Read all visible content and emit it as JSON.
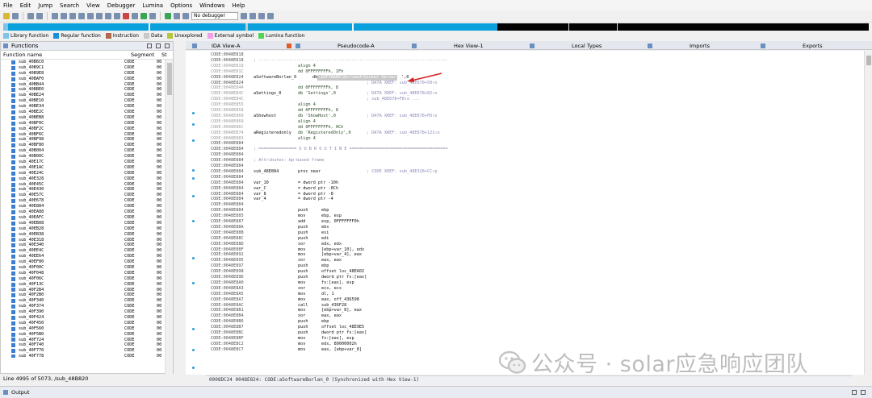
{
  "menubar": [
    "File",
    "Edit",
    "Jump",
    "Search",
    "View",
    "Debugger",
    "Lumina",
    "Options",
    "Windows",
    "Help"
  ],
  "toolbar": {
    "debugger_label": "No debugger"
  },
  "legend": [
    {
      "label": "Library function",
      "color": "#7fc4e8"
    },
    {
      "label": "Regular function",
      "color": "#1a8fd8"
    },
    {
      "label": "Instruction",
      "color": "#b06a4a"
    },
    {
      "label": "Data",
      "color": "#c8c8c8"
    },
    {
      "label": "Unexplored",
      "color": "#b8c43a"
    },
    {
      "label": "External symbol",
      "color": "#f0a0e8"
    },
    {
      "label": "Lumina function",
      "color": "#54d454"
    }
  ],
  "functions_panel": {
    "title": "Functions",
    "col_name": "Function name",
    "col_segment": "Segment",
    "col_s": "St",
    "rows": [
      [
        "sub_40B6C0",
        "CODE",
        "00"
      ],
      [
        "sub_40B9C1",
        "CODE",
        "00"
      ],
      [
        "sub_40B9E8",
        "CODE",
        "00"
      ],
      [
        "sub_40BAF0",
        "CODE",
        "00"
      ],
      [
        "sub_40BB44",
        "CODE",
        "00"
      ],
      [
        "sub_40BBE0",
        "CODE",
        "00"
      ],
      [
        "sub_40BE24",
        "CODE",
        "00"
      ],
      [
        "sub_40BE10",
        "CODE",
        "00"
      ],
      [
        "sub_40BE34",
        "CODE",
        "00"
      ],
      [
        "sub_40BE2C",
        "CODE",
        "00"
      ],
      [
        "sub_40BEB8",
        "CODE",
        "00"
      ],
      [
        "sub_40BF0C",
        "CODE",
        "00"
      ],
      [
        "sub_40BF2C",
        "CODE",
        "00"
      ],
      [
        "sub_40BF6C",
        "CODE",
        "00"
      ],
      [
        "sub_40BF98",
        "CODE",
        "00"
      ],
      [
        "sub_40BF80",
        "CODE",
        "00"
      ],
      [
        "sub_40B004",
        "CODE",
        "00"
      ],
      [
        "sub_40B00C",
        "CODE",
        "00"
      ],
      [
        "sub_40E17C",
        "CODE",
        "00"
      ],
      [
        "sub_40E1AC",
        "CODE",
        "00"
      ],
      [
        "sub_40E24C",
        "CODE",
        "00"
      ],
      [
        "sub_40E328",
        "CODE",
        "00"
      ],
      [
        "sub_40E45C",
        "CODE",
        "00"
      ],
      [
        "sub_40E430",
        "CODE",
        "00"
      ],
      [
        "sub_40E57C",
        "CODE",
        "00"
      ],
      [
        "sub_40E678",
        "CODE",
        "00"
      ],
      [
        "sub_40E884",
        "CODE",
        "00"
      ],
      [
        "sub_40EA88",
        "CODE",
        "00"
      ],
      [
        "sub_40EAFC",
        "CODE",
        "00"
      ],
      [
        "sub_40EB08",
        "CODE",
        "00"
      ],
      [
        "sub_40EB28",
        "CODE",
        "00"
      ],
      [
        "sub_40EB38",
        "CODE",
        "00"
      ],
      [
        "sub_40E318",
        "CODE",
        "00"
      ],
      [
        "sub_40E340",
        "CODE",
        "00"
      ],
      [
        "sub_40EE4C",
        "CODE",
        "00"
      ],
      [
        "sub_40EE64",
        "CODE",
        "00"
      ],
      [
        "sub_40EF80",
        "CODE",
        "00"
      ],
      [
        "sub_40F00C",
        "CODE",
        "00"
      ],
      [
        "sub_40F048",
        "CODE",
        "00"
      ],
      [
        "sub_40F06C",
        "CODE",
        "00"
      ],
      [
        "sub_40F13C",
        "CODE",
        "00"
      ],
      [
        "sub_40F2B4",
        "CODE",
        "00"
      ],
      [
        "sub_40F2B0",
        "CODE",
        "00"
      ],
      [
        "sub_40F340",
        "CODE",
        "00"
      ],
      [
        "sub_40F374",
        "CODE",
        "00"
      ],
      [
        "sub_40F390",
        "CODE",
        "00"
      ],
      [
        "sub_40F424",
        "CODE",
        "00"
      ],
      [
        "sub_40F450",
        "CODE",
        "00"
      ],
      [
        "sub_40F560",
        "CODE",
        "00"
      ],
      [
        "sub_40F5B0",
        "CODE",
        "00"
      ],
      [
        "sub_40F724",
        "CODE",
        "00"
      ],
      [
        "sub_40F740",
        "CODE",
        "00"
      ],
      [
        "sub_40F770",
        "CODE",
        "00"
      ],
      [
        "sub_40F778",
        "CODE",
        "00"
      ]
    ],
    "status": "Line 4995 of 5073, /sub_48B820"
  },
  "tabs": [
    {
      "label": "IDA View-A",
      "active": true
    },
    {
      "label": "Pseudocode-A"
    },
    {
      "label": "Hex View-1"
    },
    {
      "label": "Local Types"
    },
    {
      "label": "Imports"
    },
    {
      "label": "Exports"
    }
  ],
  "code_lines": [
    {
      "addr": "CODE:0048E818",
      "lbl": "",
      "mn": "",
      "op": "",
      "cmt": "",
      "grey": false
    },
    {
      "addr": "CODE:0048E818",
      "lbl": "; ---------------------------------------------------------------------------",
      "mn": "",
      "op": "",
      "cmt": "",
      "grey": false
    },
    {
      "addr": "CODE:0048E819",
      "lbl": "",
      "mn": "align 4",
      "op": "",
      "cmt": "",
      "grey": true
    },
    {
      "addr": "CODE:0048E81C",
      "lbl": "",
      "mn": "dd 0FFFFFFFFh, 1Fh",
      "op": "",
      "cmt": "",
      "grey": true
    },
    {
      "addr": "CODE:0048E824",
      "lbl": "aSoftwareBorlan_0",
      "mn": "db '",
      "op": "\\SOFTWARE\\Borland\\Socket Server",
      "cmt": "',0",
      "grey": false,
      "hl": true
    },
    {
      "addr": "CODE:0048E824",
      "lbl": "",
      "mn": "",
      "op": "",
      "cmt": "; DATA XREF: sub_48E678+50↑o",
      "grey": false
    },
    {
      "addr": "CODE:0048E844",
      "lbl": "",
      "mn": "dd 0FFFFFFFFh, 8",
      "op": "",
      "cmt": "",
      "grey": true
    },
    {
      "addr": "CODE:0048E84C",
      "lbl": "aSettings_0",
      "mn": "db 'Settings',0",
      "op": "",
      "cmt": "; DATA XREF: sub_48E678+82↑o",
      "grey": true
    },
    {
      "addr": "CODE:0048E84C",
      "lbl": "",
      "mn": "",
      "op": "",
      "cmt": "; sub_48E678+F8↑o ...",
      "grey": true
    },
    {
      "addr": "CODE:0048E855",
      "lbl": "",
      "mn": "align 4",
      "op": "",
      "cmt": "",
      "grey": true
    },
    {
      "addr": "CODE:0048E858",
      "lbl": "",
      "mn": "dd 0FFFFFFFFh, 8",
      "op": "",
      "cmt": "",
      "grey": true
    },
    {
      "addr": "CODE:0048E860",
      "lbl": "aShowhost",
      "mn": "db 'ShowHost',0",
      "op": "",
      "cmt": "; DATA XREF: sub_48E678+FD↑o",
      "grey": true
    },
    {
      "addr": "CODE:0048E869",
      "lbl": "",
      "mn": "align 4",
      "op": "",
      "cmt": "",
      "grey": true
    },
    {
      "addr": "CODE:0048E86C",
      "lbl": "",
      "mn": "dd 0FFFFFFFFh, 0Ch",
      "op": "",
      "cmt": "",
      "grey": true
    },
    {
      "addr": "CODE:0048E874",
      "lbl": "aRegisteredonly",
      "mn": "db 'RegisteredOnly',0",
      "op": "",
      "cmt": "; DATA XREF: sub_48E678+121↑o",
      "grey": true
    },
    {
      "addr": "CODE:0048E883",
      "lbl": "",
      "mn": "align 4",
      "op": "",
      "cmt": "",
      "grey": true
    },
    {
      "addr": "CODE:0048E884",
      "lbl": "",
      "mn": "",
      "op": "",
      "cmt": "",
      "grey": false
    },
    {
      "addr": "CODE:0048E884",
      "lbl": "; =============== S U B R O U T I N E =======================================",
      "mn": "",
      "op": "",
      "cmt": "",
      "grey": false
    },
    {
      "addr": "CODE:0048E884",
      "lbl": "",
      "mn": "",
      "op": "",
      "cmt": "",
      "grey": false
    },
    {
      "addr": "CODE:0048E884",
      "lbl": "; Attributes: bp-based frame",
      "mn": "",
      "op": "",
      "cmt": "",
      "grey": false
    },
    {
      "addr": "CODE:0048E884",
      "lbl": "",
      "mn": "",
      "op": "",
      "cmt": "",
      "grey": false
    },
    {
      "addr": "CODE:0048E884",
      "lbl": "sub_48E884",
      "mn": "proc near",
      "op": "",
      "cmt": "; CODE XREF: sub_48E328+CC↑p",
      "grey": false
    },
    {
      "addr": "CODE:0048E884",
      "lbl": "",
      "mn": "",
      "op": "",
      "cmt": "",
      "grey": false
    },
    {
      "addr": "CODE:0048E884",
      "lbl": "var_10",
      "mn": "= dword ptr -10h",
      "op": "",
      "cmt": "",
      "grey": false
    },
    {
      "addr": "CODE:0048E884",
      "lbl": "var_C",
      "mn": "= dword ptr -0Ch",
      "op": "",
      "cmt": "",
      "grey": false
    },
    {
      "addr": "CODE:0048E884",
      "lbl": "var_8",
      "mn": "= dword ptr -8",
      "op": "",
      "cmt": "",
      "grey": false
    },
    {
      "addr": "CODE:0048E884",
      "lbl": "var_4",
      "mn": "= dword ptr -4",
      "op": "",
      "cmt": "",
      "grey": false
    },
    {
      "addr": "CODE:0048E884",
      "lbl": "",
      "mn": "",
      "op": "",
      "cmt": "",
      "grey": false
    },
    {
      "addr": "CODE:0048E884",
      "lbl": "",
      "mn": "push",
      "op": "ebp",
      "cmt": "",
      "grey": false
    },
    {
      "addr": "CODE:0048E885",
      "lbl": "",
      "mn": "mov",
      "op": "ebp, esp",
      "cmt": "",
      "grey": false
    },
    {
      "addr": "CODE:0048E887",
      "lbl": "",
      "mn": "add",
      "op": "esp, 0FFFFFFF0h",
      "cmt": "",
      "grey": false
    },
    {
      "addr": "CODE:0048E88A",
      "lbl": "",
      "mn": "push",
      "op": "ebx",
      "cmt": "",
      "grey": false
    },
    {
      "addr": "CODE:0048E88B",
      "lbl": "",
      "mn": "push",
      "op": "esi",
      "cmt": "",
      "grey": false
    },
    {
      "addr": "CODE:0048E88C",
      "lbl": "",
      "mn": "push",
      "op": "edi",
      "cmt": "",
      "grey": false
    },
    {
      "addr": "CODE:0048E88D",
      "lbl": "",
      "mn": "xor",
      "op": "edx, edx",
      "cmt": "",
      "grey": false
    },
    {
      "addr": "CODE:0048E88F",
      "lbl": "",
      "mn": "mov",
      "op": "[ebp+var_10], edx",
      "cmt": "",
      "grey": false
    },
    {
      "addr": "CODE:0048E892",
      "lbl": "",
      "mn": "mov",
      "op": "[ebp+var_4], eax",
      "cmt": "",
      "grey": false
    },
    {
      "addr": "CODE:0048E895",
      "lbl": "",
      "mn": "xor",
      "op": "eax, eax",
      "cmt": "",
      "grey": false
    },
    {
      "addr": "CODE:0048E897",
      "lbl": "",
      "mn": "push",
      "op": "ebp",
      "cmt": "",
      "grey": false
    },
    {
      "addr": "CODE:0048E898",
      "lbl": "",
      "mn": "push",
      "op": "offset loc_48EA02",
      "cmt": "",
      "grey": false
    },
    {
      "addr": "CODE:0048E89D",
      "lbl": "",
      "mn": "push",
      "op": "dword ptr fs:[eax]",
      "cmt": "",
      "grey": false
    },
    {
      "addr": "CODE:0048E8A0",
      "lbl": "",
      "mn": "mov",
      "op": "fs:[eax], esp",
      "cmt": "",
      "grey": false
    },
    {
      "addr": "CODE:0048E8A3",
      "lbl": "",
      "mn": "xor",
      "op": "ecx, ecx",
      "cmt": "",
      "grey": false
    },
    {
      "addr": "CODE:0048E8A5",
      "lbl": "",
      "mn": "mov",
      "op": "dl, 1",
      "cmt": "",
      "grey": false
    },
    {
      "addr": "CODE:0048E8A7",
      "lbl": "",
      "mn": "mov",
      "op": "eax, off_436598",
      "cmt": "",
      "grey": false
    },
    {
      "addr": "CODE:0048E8AC",
      "lbl": "",
      "mn": "call",
      "op": "sub_436F28",
      "cmt": "",
      "grey": false
    },
    {
      "addr": "CODE:0048E8B1",
      "lbl": "",
      "mn": "mov",
      "op": "[ebp+var_8], eax",
      "cmt": "",
      "grey": false
    },
    {
      "addr": "CODE:0048E8B4",
      "lbl": "",
      "mn": "xor",
      "op": "eax, eax",
      "cmt": "",
      "grey": false
    },
    {
      "addr": "CODE:0048E8B6",
      "lbl": "",
      "mn": "push",
      "op": "ebp",
      "cmt": "",
      "grey": false
    },
    {
      "addr": "CODE:0048E8B7",
      "lbl": "",
      "mn": "push",
      "op": "offset loc_48E9E5",
      "cmt": "",
      "grey": false
    },
    {
      "addr": "CODE:0048E8BC",
      "lbl": "",
      "mn": "push",
      "op": "dword ptr fs:[eax]",
      "cmt": "",
      "grey": false
    },
    {
      "addr": "CODE:0048E8BF",
      "lbl": "",
      "mn": "mov",
      "op": "fs:[eax], esp",
      "cmt": "",
      "grey": false
    },
    {
      "addr": "CODE:0048E8C2",
      "lbl": "",
      "mn": "mov",
      "op": "edx, 80000002h",
      "cmt": "",
      "grey": false
    },
    {
      "addr": "CODE:0048E8C7",
      "lbl": "",
      "mn": "mov",
      "op": "eax, [ebp+var_8]",
      "cmt": "",
      "grey": false
    }
  ],
  "code_status": "0008DC24 0048E824: CODE:aSoftwareBorlan_0 (Synchronized with Hex View-1)",
  "output_label": "Output",
  "watermark": "公众号 · solar应急响应团队",
  "colors": {
    "accent_blue": "#0aa0dc",
    "arrow_red": "#d42020"
  }
}
